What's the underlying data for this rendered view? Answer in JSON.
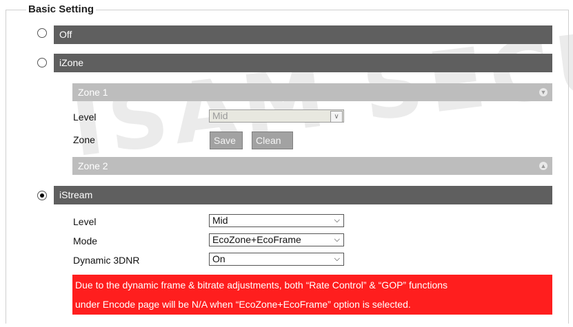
{
  "watermark": "ISAM SECUR",
  "legend": "Basic Setting",
  "options": {
    "off": {
      "label": "Off",
      "selected": false
    },
    "izone": {
      "label": "iZone",
      "selected": false
    },
    "istream": {
      "label": "iStream",
      "selected": true
    }
  },
  "izone": {
    "zone1": {
      "title": "Zone 1",
      "icon": "chevron-down-icon"
    },
    "level_label": "Level",
    "level_value": "Mid",
    "zone_label": "Zone",
    "save_label": "Save",
    "clean_label": "Clean",
    "zone2": {
      "title": "Zone 2",
      "icon": "chevron-up-icon"
    }
  },
  "istream": {
    "level_label": "Level",
    "level_value": "Mid",
    "mode_label": "Mode",
    "mode_value": "EcoZone+EcoFrame",
    "dnr_label": "Dynamic 3DNR",
    "dnr_value": "On"
  },
  "warning": {
    "line1": "Due to the dynamic frame & bitrate adjustments, both “Rate Control” & “GOP” functions",
    "line2": "under Encode page will be N/A when “EcoZone+EcoFrame” option is selected."
  },
  "colors": {
    "section_bar": "#5f5f5f",
    "zone_bar": "#bdbdbd",
    "warning_bg": "#ff1e1e"
  }
}
